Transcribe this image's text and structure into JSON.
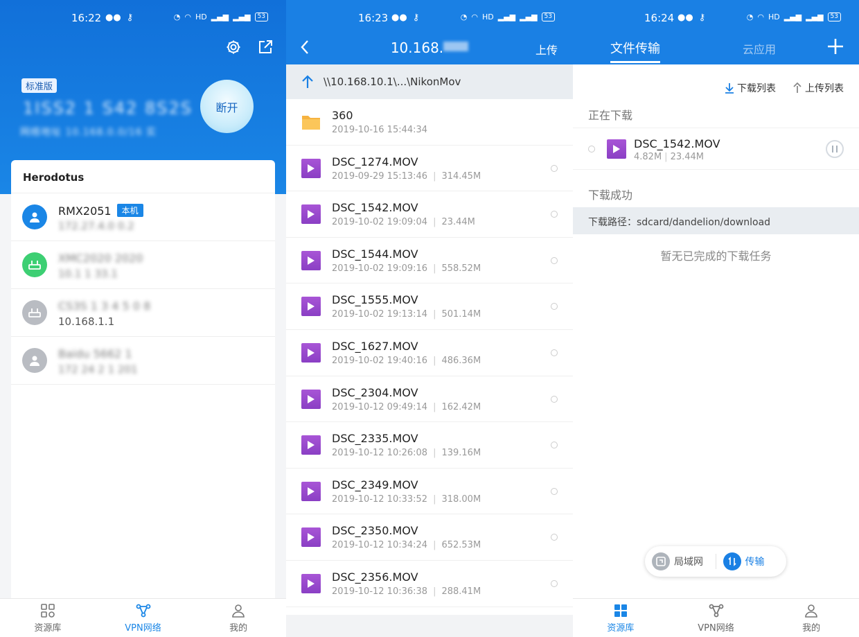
{
  "screens": {
    "vpn": {
      "status": {
        "time": "16:22",
        "network": "HD",
        "battery": "53"
      },
      "badge": "标准版",
      "device_id": "1ISS2 1 S42 8S2S",
      "subtitle": "网络地址 10.168.0.0/16 实",
      "disconnect_label": "断开",
      "card_title": "Herodotus",
      "devices": [
        {
          "name": "RMX2051",
          "tag": "本机",
          "ip": "172.27.4.0 0.2",
          "avatar_color": "#1a86e6"
        },
        {
          "name": "XMC2020 2020",
          "tag": "",
          "ip": "10.1 1 33.1",
          "avatar_color": "#3dcf73"
        },
        {
          "name": "CS3S 1 3 4 5 0 8",
          "tag": "",
          "ip": "10.168.1.1",
          "avatar_color": "#b9bcc2"
        },
        {
          "name": "Baidu 5662 1",
          "tag": "",
          "ip": "172 24 2 1 201",
          "avatar_color": "#b9bcc2"
        }
      ],
      "nav": [
        {
          "label": "资源库",
          "icon": "grid-icon",
          "active": false
        },
        {
          "label": "VPN网络",
          "icon": "vpn-network-icon",
          "active": true
        },
        {
          "label": "我的",
          "icon": "person-icon",
          "active": false
        }
      ]
    },
    "browser": {
      "status": {
        "time": "16:23",
        "network": "HD",
        "battery": "53"
      },
      "title": "10.168.",
      "upload_label": "上传",
      "path": "\\\\10.168.10.1\\...\\NikonMov",
      "files": [
        {
          "name": "360",
          "date": "2019-10-16 15:44:34",
          "size": "",
          "type": "folder"
        },
        {
          "name": "DSC_1274.MOV",
          "date": "2019-09-29 15:13:46",
          "size": "314.45M",
          "type": "video"
        },
        {
          "name": "DSC_1542.MOV",
          "date": "2019-10-02 19:09:04",
          "size": "23.44M",
          "type": "video"
        },
        {
          "name": "DSC_1544.MOV",
          "date": "2019-10-02 19:09:16",
          "size": "558.52M",
          "type": "video"
        },
        {
          "name": "DSC_1555.MOV",
          "date": "2019-10-02 19:13:14",
          "size": "501.14M",
          "type": "video"
        },
        {
          "name": "DSC_1627.MOV",
          "date": "2019-10-02 19:40:16",
          "size": "486.36M",
          "type": "video"
        },
        {
          "name": "DSC_2304.MOV",
          "date": "2019-10-12 09:49:14",
          "size": "162.42M",
          "type": "video"
        },
        {
          "name": "DSC_2335.MOV",
          "date": "2019-10-12 10:26:08",
          "size": "139.16M",
          "type": "video"
        },
        {
          "name": "DSC_2349.MOV",
          "date": "2019-10-12 10:33:52",
          "size": "318.00M",
          "type": "video"
        },
        {
          "name": "DSC_2350.MOV",
          "date": "2019-10-12 10:34:24",
          "size": "652.53M",
          "type": "video"
        },
        {
          "name": "DSC_2356.MOV",
          "date": "2019-10-12 10:36:38",
          "size": "288.41M",
          "type": "video"
        }
      ]
    },
    "transfer": {
      "status": {
        "time": "16:24",
        "network": "HD",
        "battery": "53"
      },
      "tab_active": "文件传输",
      "tab_inactive": "云应用",
      "download_list": "下载列表",
      "upload_list": "上传列表",
      "section_downloading": "正在下载",
      "downloading": {
        "name": "DSC_1542.MOV",
        "done": "4.82M",
        "total": "23.44M"
      },
      "section_done": "下载成功",
      "download_path": "下载路径：sdcard/dandelion/download",
      "empty": "暂无已完成的下载任务",
      "float": {
        "lan": "局域网",
        "transfer": "传输"
      },
      "nav": [
        {
          "label": "资源库",
          "icon": "grid-icon",
          "active": true
        },
        {
          "label": "VPN网络",
          "icon": "vpn-network-icon",
          "active": false
        },
        {
          "label": "我的",
          "icon": "person-icon",
          "active": false
        }
      ]
    }
  },
  "colors": {
    "primary": "#1a80e4",
    "video": "#9b4bd0",
    "folder": "#f6b340"
  }
}
